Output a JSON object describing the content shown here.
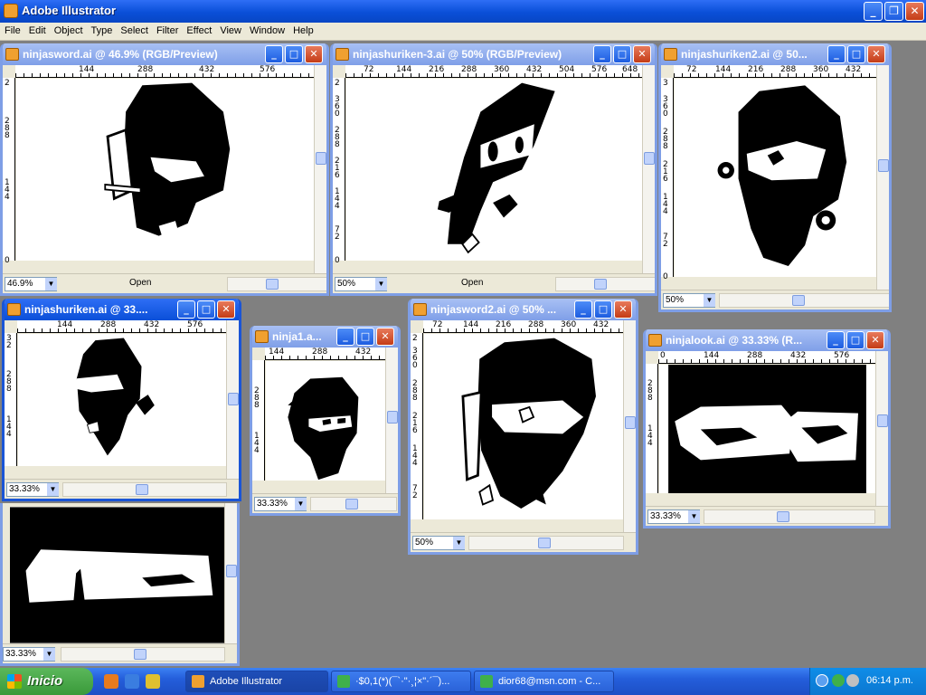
{
  "app": {
    "title": "Adobe Illustrator"
  },
  "menu": [
    "File",
    "Edit",
    "Object",
    "Type",
    "Select",
    "Filter",
    "Effect",
    "View",
    "Window",
    "Help"
  ],
  "windows": [
    {
      "title": "ninjasword.ai @ 46.9% (RGB/Preview)",
      "zoom": "46.9%",
      "status": "Open",
      "ruler_h": [
        "144",
        "288",
        "432",
        "576"
      ],
      "ruler_v": [
        "2",
        "2 8 8",
        "1 4 4",
        "0"
      ]
    },
    {
      "title": "ninjashuriken-3.ai @ 50% (RGB/Preview)",
      "zoom": "50%",
      "status": "Open",
      "ruler_h": [
        "72",
        "144",
        "216",
        "288",
        "360",
        "432",
        "504",
        "576",
        "648"
      ],
      "ruler_v": [
        "2",
        "3 6 0",
        "2 8 8",
        "2 1 6",
        "1 4 4",
        "7 2",
        "0"
      ]
    },
    {
      "title": "ninjashuriken2.ai @ 50...",
      "zoom": "50%",
      "ruler_h": [
        "72",
        "144",
        "216",
        "288",
        "360",
        "432"
      ],
      "ruler_v": [
        "3",
        "3 6 0",
        "2 8 8",
        "2 1 6",
        "1 4 4",
        "7 2",
        "0"
      ]
    },
    {
      "title": "ninjashuriken.ai @ 33....",
      "zoom": "33.33%",
      "ruler_h": [
        "144",
        "288",
        "432",
        "576"
      ],
      "ruler_v": [
        "3 2",
        "2 8 8",
        "1 4 4"
      ]
    },
    {
      "title": "ninja1.a...",
      "zoom": "33.33%",
      "ruler_h": [
        "144",
        "288",
        "432"
      ],
      "ruler_v": [
        "2 8 8",
        "1 4 4"
      ]
    },
    {
      "title": "ninjasword2.ai @ 50% ...",
      "zoom": "50%",
      "ruler_h": [
        "72",
        "144",
        "216",
        "288",
        "360",
        "432"
      ],
      "ruler_v": [
        "2",
        "3 6 0",
        "2 8 8",
        "2 1 6",
        "1 4 4",
        "7 2"
      ]
    },
    {
      "title": "ninjalook.ai @ 33.33% (R...",
      "zoom": "33.33%",
      "ruler_h": [
        "0",
        "144",
        "288",
        "432",
        "576"
      ],
      "ruler_v": [
        "2 8 8",
        "1 4 4"
      ]
    },
    {
      "title": "",
      "zoom": "33.33%"
    }
  ],
  "taskbar": {
    "start_label": "Inicio",
    "tasks": [
      {
        "label": "Adobe Illustrator"
      },
      {
        "label": "·$0,1(*)(¯`·\"·¸¦×\"·´¯)..."
      },
      {
        "label": "dior68@msn.com - C..."
      }
    ],
    "clock": "06:14 p.m."
  },
  "colors": {
    "titlebar": "#0a4fd8",
    "desktop": "#808080",
    "taskbar": "#245edb",
    "start": "#3a9a3a"
  }
}
